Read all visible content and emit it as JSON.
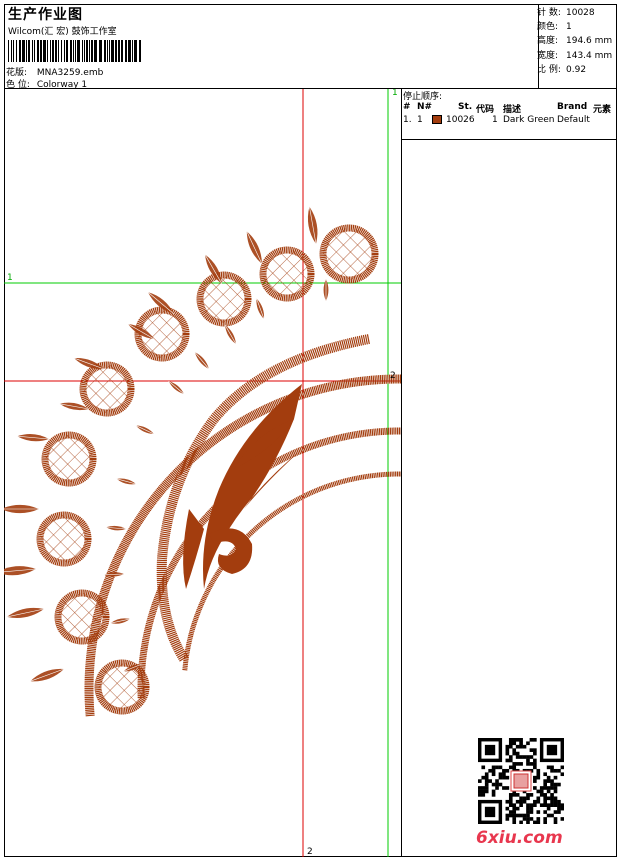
{
  "header": {
    "title": "生产作业图",
    "company": "Wilcom(汇 宏) 鼓饰工作室",
    "design_label": "花版:",
    "design_value": "MNA3259.emb",
    "colorway_label": "色 位:",
    "colorway_value": "Colorway 1"
  },
  "stats": [
    {
      "label": "针 数:",
      "value": "10028"
    },
    {
      "label": "颜色:",
      "value": "1"
    },
    {
      "label": "高度:",
      "value": "194.6 mm"
    },
    {
      "label": "宽度:",
      "value": "143.4 mm"
    },
    {
      "label": "比 例:",
      "value": "0.92"
    }
  ],
  "stop_sequence": {
    "title": "停止顺序:",
    "columns": [
      "#",
      "N#",
      "St.",
      "代码",
      "描述",
      "Brand",
      "元素"
    ],
    "rows": [
      {
        "index": "1.",
        "n": "1",
        "st": "10026",
        "code": "1",
        "desc": "Dark Green",
        "brand": "Default"
      }
    ]
  },
  "guides": {
    "top_left": "1",
    "top_right": "1",
    "mid_right": "2",
    "bottom": "2"
  },
  "watermark": "6xiu.com",
  "colors": {
    "thread": "#a33d0e",
    "guide_green": "#00cc00",
    "guide_red": "#dd0000"
  }
}
